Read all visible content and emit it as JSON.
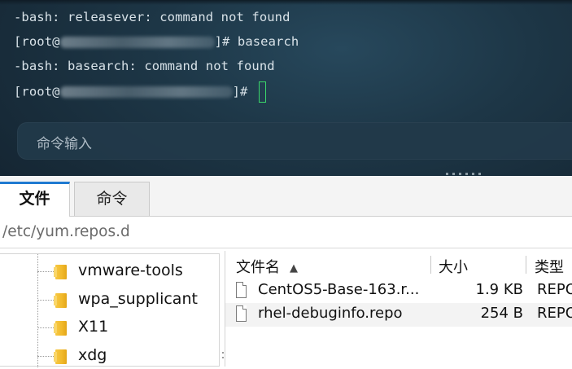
{
  "terminal": {
    "lines": [
      {
        "text": "-bash: releasever: command not found"
      },
      {
        "prompt_start": "[root@",
        "prompt_end": "]# ",
        "command": "basearch"
      },
      {
        "text": "-bash: basearch: command not found"
      },
      {
        "prompt_start": "[root@",
        "prompt_end": "]# ",
        "command": ""
      }
    ],
    "command_input_placeholder": "命令输入"
  },
  "tabs": [
    {
      "label": "文件",
      "active": true
    },
    {
      "label": "命令",
      "active": false
    }
  ],
  "path": "/etc/yum.repos.d",
  "tree": {
    "items": [
      {
        "label": "vmware-tools",
        "icon": "folder-icon"
      },
      {
        "label": "wpa_supplicant",
        "icon": "folder-icon"
      },
      {
        "label": "X11",
        "icon": "folder-icon"
      },
      {
        "label": "xdg",
        "icon": "folder-icon"
      }
    ]
  },
  "file_list": {
    "columns": [
      {
        "label": "文件名",
        "sort": "ascending"
      },
      {
        "label": "大小"
      },
      {
        "label": "类型"
      }
    ],
    "rows": [
      {
        "name": "CentOS5-Base-163.r...",
        "size": "1.9 KB",
        "type": "REPO"
      },
      {
        "name": "rhel-debuginfo.repo",
        "size": "254 B",
        "type": "REPO"
      }
    ]
  },
  "colors": {
    "accent": "#1f7ad1",
    "cursor": "#3ad66a",
    "terminal_bg": "#1d3646"
  }
}
